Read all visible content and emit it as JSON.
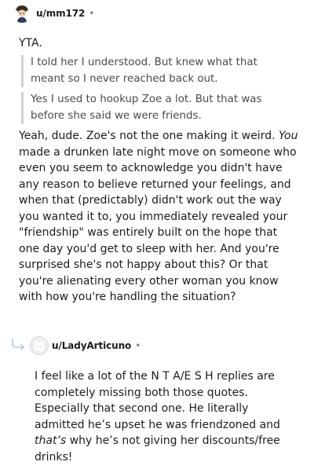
{
  "comment1": {
    "username": "u/mm172",
    "separator": "•",
    "verdict": "YTA.",
    "quote1": "I told her I understood. But knew what that meant so I never reached back out.",
    "quote2": "Yes I used to hookup Zoe a lot. But that was before she said we were friends.",
    "body_part1": "Yeah, dude. Zoe's not the one making it weird. ",
    "body_em": "You",
    "body_part2": " made a drunken late night move on someone who even you seem to acknowledge you didn't have any reason to believe returned your feelings, and when that (predictably) didn't work out the way you wanted it to, you immediately revealed your \"friendship\" was entirely built on the hope that one day you'd get to sleep with her. And you're surprised she's not happy about this? Or that you're alienating every other woman you know with how you're handling the situation?"
  },
  "comment2": {
    "username": "u/LadyArticuno",
    "separator": "•",
    "body_part1": "I feel like a lot of the N T A/E S H replies are completely missing both those quotes. Especially that second one. He literally admitted he’s upset he was friendzoned and ",
    "body_em": "that’s",
    "body_part2": " why he’s not giving her discounts/free drinks!"
  },
  "icons": {
    "avatar1": "user-avatar-icon",
    "avatar2": "default-avatar-icon",
    "reply": "reply-arrow-icon"
  }
}
